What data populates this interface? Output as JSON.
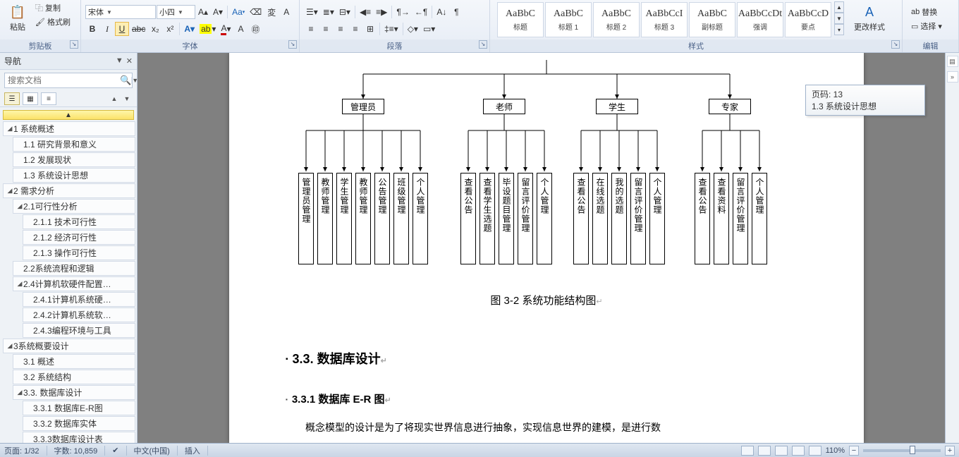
{
  "ribbon": {
    "clipboard": {
      "label": "剪贴板",
      "paste": "粘贴",
      "copy": "复制",
      "format_painter": "格式刷"
    },
    "font": {
      "label": "字体",
      "family": "宋体",
      "size": "小四",
      "bold": "B",
      "italic": "I",
      "underline": "U",
      "strike": "abc",
      "sub": "x₂",
      "sup": "x²"
    },
    "paragraph": {
      "label": "段落"
    },
    "styles": {
      "label": "样式",
      "items": [
        {
          "sample": "AaBbC",
          "name": "标题"
        },
        {
          "sample": "AaBbC",
          "name": "标题 1"
        },
        {
          "sample": "AaBbC",
          "name": "标题 2"
        },
        {
          "sample": "AaBbCcI",
          "name": "标题 3"
        },
        {
          "sample": "AaBbC",
          "name": "副标题"
        },
        {
          "sample": "AaBbCcDt",
          "name": "强调"
        },
        {
          "sample": "AaBbCcD",
          "name": "要点"
        }
      ],
      "change": "更改样式"
    },
    "editing": {
      "label": "编辑",
      "replace": "替换",
      "select": "选择"
    }
  },
  "navpane": {
    "title": "导航",
    "search_placeholder": "搜索文档",
    "tree": [
      {
        "lvl": 1,
        "tw": "◢",
        "text": "1 系统概述"
      },
      {
        "lvl": 2,
        "tw": "",
        "text": "1.1 研究背景和意义"
      },
      {
        "lvl": 2,
        "tw": "",
        "text": "1.2 发展现状"
      },
      {
        "lvl": 2,
        "tw": "",
        "text": "1.3 系统设计思想"
      },
      {
        "lvl": 1,
        "tw": "◢",
        "text": "2 需求分析"
      },
      {
        "lvl": 2,
        "tw": "◢",
        "text": "2.1可行性分析"
      },
      {
        "lvl": 3,
        "tw": "",
        "text": "2.1.1 技术可行性"
      },
      {
        "lvl": 3,
        "tw": "",
        "text": "2.1.2 经济可行性"
      },
      {
        "lvl": 3,
        "tw": "",
        "text": "2.1.3 操作可行性"
      },
      {
        "lvl": 2,
        "tw": "",
        "text": "2.2系统流程和逻辑"
      },
      {
        "lvl": 2,
        "tw": "◢",
        "text": "2.4计算机软硬件配置…"
      },
      {
        "lvl": 3,
        "tw": "",
        "text": "2.4.1计算机系统硬…"
      },
      {
        "lvl": 3,
        "tw": "",
        "text": "2.4.2计算机系统软…"
      },
      {
        "lvl": 3,
        "tw": "",
        "text": "2.4.3编程环境与工具"
      },
      {
        "lvl": 1,
        "tw": "◢",
        "text": "3系统概要设计"
      },
      {
        "lvl": 2,
        "tw": "",
        "text": "3.1 概述"
      },
      {
        "lvl": 2,
        "tw": "",
        "text": "3.2 系统结构"
      },
      {
        "lvl": 2,
        "tw": "◢",
        "text": "3.3. 数据库设计"
      },
      {
        "lvl": 3,
        "tw": "",
        "text": "3.3.1 数据库E-R图"
      },
      {
        "lvl": 3,
        "tw": "",
        "text": "3.3.2 数据库实体"
      },
      {
        "lvl": 3,
        "tw": "",
        "text": "3.3.3数据库设计表"
      }
    ]
  },
  "document": {
    "top_nodes": [
      "管理员",
      "老师",
      "学生",
      "专家"
    ],
    "leaves": {
      "g1": [
        "管理员管理",
        "教师管理",
        "学生管理",
        "教师管理",
        "公告管理",
        "班级管理",
        "个人管理"
      ],
      "g2": [
        "查看公告",
        "查看学生选题",
        "毕设题目管理",
        "留言评价管理",
        "个人管理"
      ],
      "g3": [
        "查看公告",
        "在线选题",
        "我的选题",
        "留言评价管理",
        "个人管理"
      ],
      "g4": [
        "查看公告",
        "查看资料",
        "留言评价管理",
        "个人管理"
      ]
    },
    "fig_caption": "图 3-2 系统功能结构图",
    "h3": "3.3. 数据库设计",
    "h4": "3.3.1 数据库 E-R 图",
    "p": "概念模型的设计是为了将现实世界信息进行抽象，实现信息世界的建模，是进行数"
  },
  "pos_tip": {
    "line1": "页码: 13",
    "line2": "1.3 系统设计思想"
  },
  "statusbar": {
    "page": "页面: 1/32",
    "words": "字数: 10,859",
    "lang": "中文(中国)",
    "mode": "插入",
    "zoom": "110%"
  }
}
